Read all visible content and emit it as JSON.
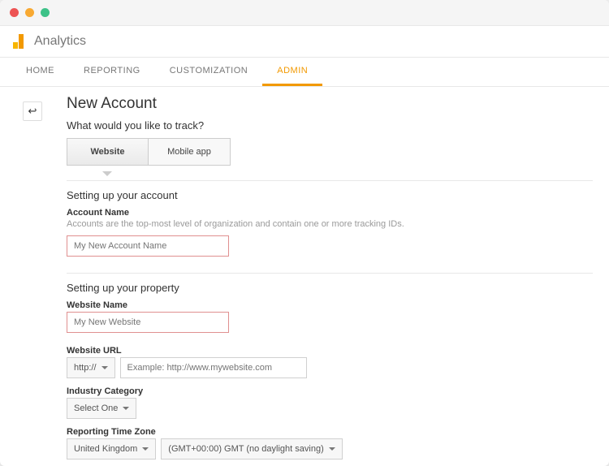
{
  "app": {
    "name": "Analytics"
  },
  "tabs": {
    "home": "HOME",
    "reporting": "REPORTING",
    "customization": "CUSTOMIZATION",
    "admin": "ADMIN"
  },
  "page": {
    "title": "New Account",
    "track_question": "What would you like to track?",
    "toggle": {
      "website": "Website",
      "mobile": "Mobile app"
    },
    "section_account": "Setting up your account",
    "account_name_label": "Account Name",
    "account_name_help": "Accounts are the top-most level of organization and contain one or more tracking IDs.",
    "account_name_placeholder": "My New Account Name",
    "section_property": "Setting up your property",
    "website_name_label": "Website Name",
    "website_name_placeholder": "My New Website",
    "website_url_label": "Website URL",
    "protocol": "http://",
    "website_url_placeholder": "Example: http://www.mywebsite.com",
    "industry_label": "Industry Category",
    "industry_value": "Select One",
    "timezone_label": "Reporting Time Zone",
    "tz_country": "United Kingdom",
    "tz_value": "(GMT+00:00) GMT (no daylight saving)"
  }
}
